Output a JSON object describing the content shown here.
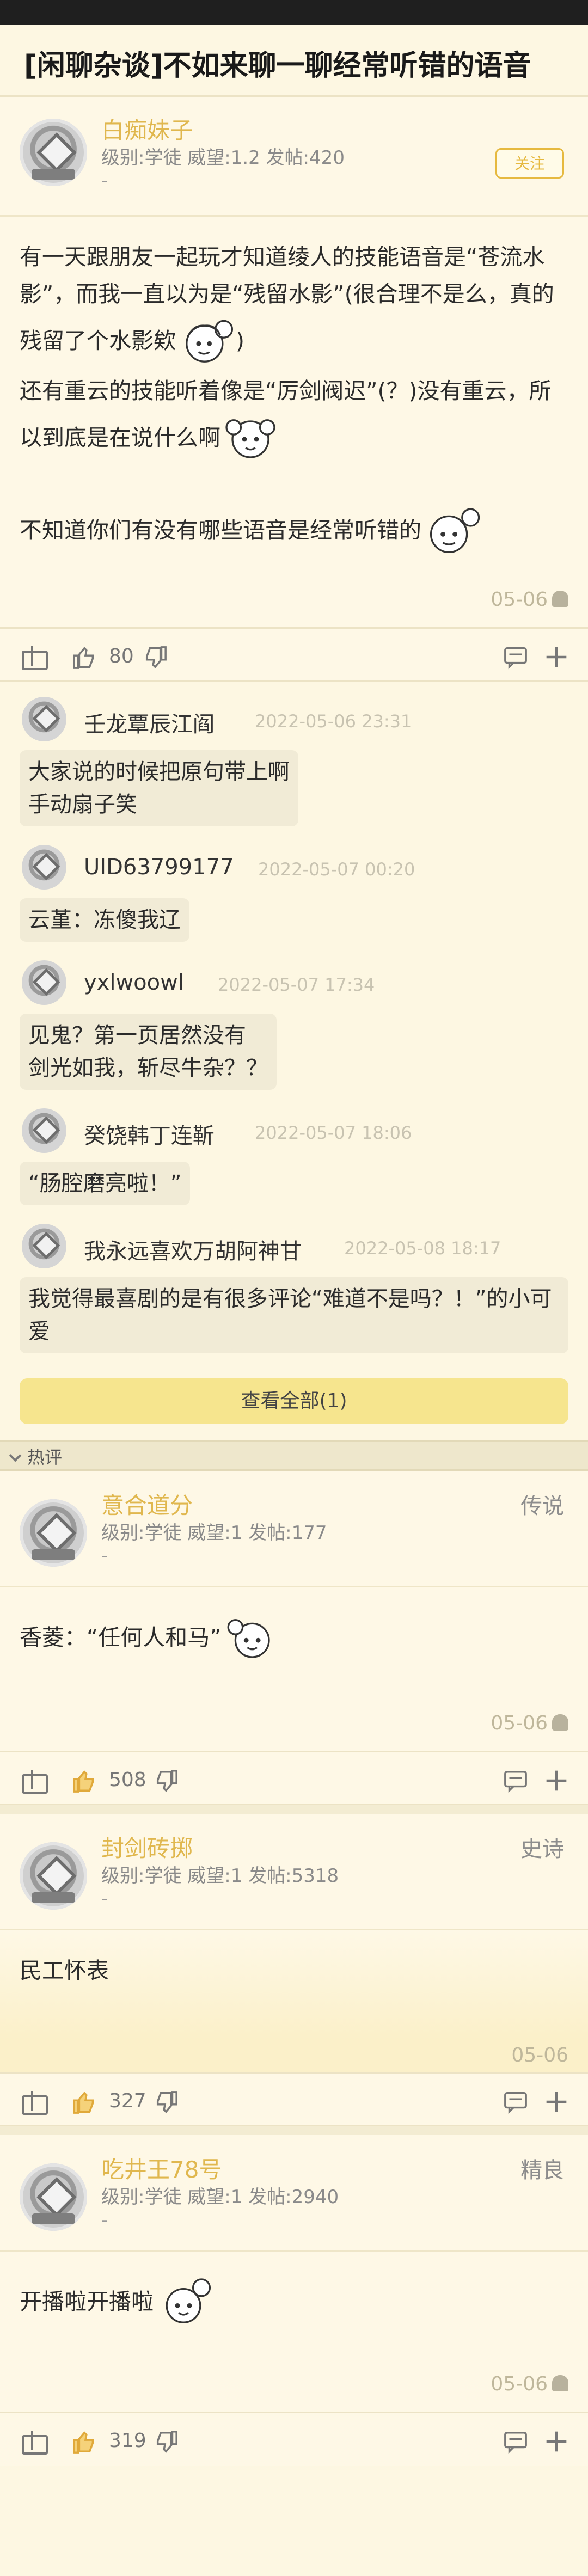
{
  "title": "[闲聊杂谈]不如来聊一聊经常听错的语音",
  "main_post": {
    "author": "白痴妹子",
    "meta": "级别:学徒 威望:1.2 发帖:420",
    "dash": "-",
    "follow_label": "关注",
    "body_p1": "有一天跟朋友一起玩才知道绫人的技能语音是“苍流水影”，而我一直以为是“残留水影”(很合理不是么，真的残留了个水影欸",
    "body_p1_close": ")",
    "body_p2": "还有重云的技能听着像是“厉剑阀迟”(？)没有重云，所以到底是在说什么啊",
    "body_p3": "不知道你们有没有哪些语音是经常听错的",
    "date": "05-06",
    "likes": "80"
  },
  "replies": [
    {
      "name": "壬龙覃辰江阎",
      "time": "2022-05-06 23:31",
      "text": "大家说的时候把原句带上啊\n手动扇子笑"
    },
    {
      "name": "UID63799177",
      "time": "2022-05-07 00:20",
      "text": "云堇：冻傻我辽"
    },
    {
      "name": "yxlwoowl",
      "time": "2022-05-07 17:34",
      "text": "见鬼？第一页居然没有\n剑光如我，斩尽牛杂？？"
    },
    {
      "name": "癸饶韩丁连靳",
      "time": "2022-05-07 18:06",
      "text": "“肠腔磨亮啦！”"
    },
    {
      "name": "我永远喜欢万胡阿神甘",
      "time": "2022-05-08 18:17",
      "text": "我觉得最喜剧的是有很多评论“难道不是吗？！”的小可爱"
    }
  ],
  "view_all_label": "查看全部(1)",
  "section_label": "热评",
  "hot_posts": [
    {
      "author": "意合道分",
      "meta": "级别:学徒 威望:1 发帖:177",
      "dash": "-",
      "tag": "传说",
      "body": "香菱：“任何人和马”",
      "date": "05-06",
      "likes": "508"
    },
    {
      "author": "封剑砖掷",
      "meta": "级别:学徒 威望:1 发帖:5318",
      "dash": "-",
      "tag": "史诗",
      "body": "民工怀表",
      "date": "05-06",
      "likes": "327"
    },
    {
      "author": "吃井王78号",
      "meta": "级别:学徒 威望:1 发帖:2940",
      "dash": "-",
      "tag": "精良",
      "body": "开播啦开播啦",
      "date": "05-06",
      "likes": "319"
    }
  ]
}
